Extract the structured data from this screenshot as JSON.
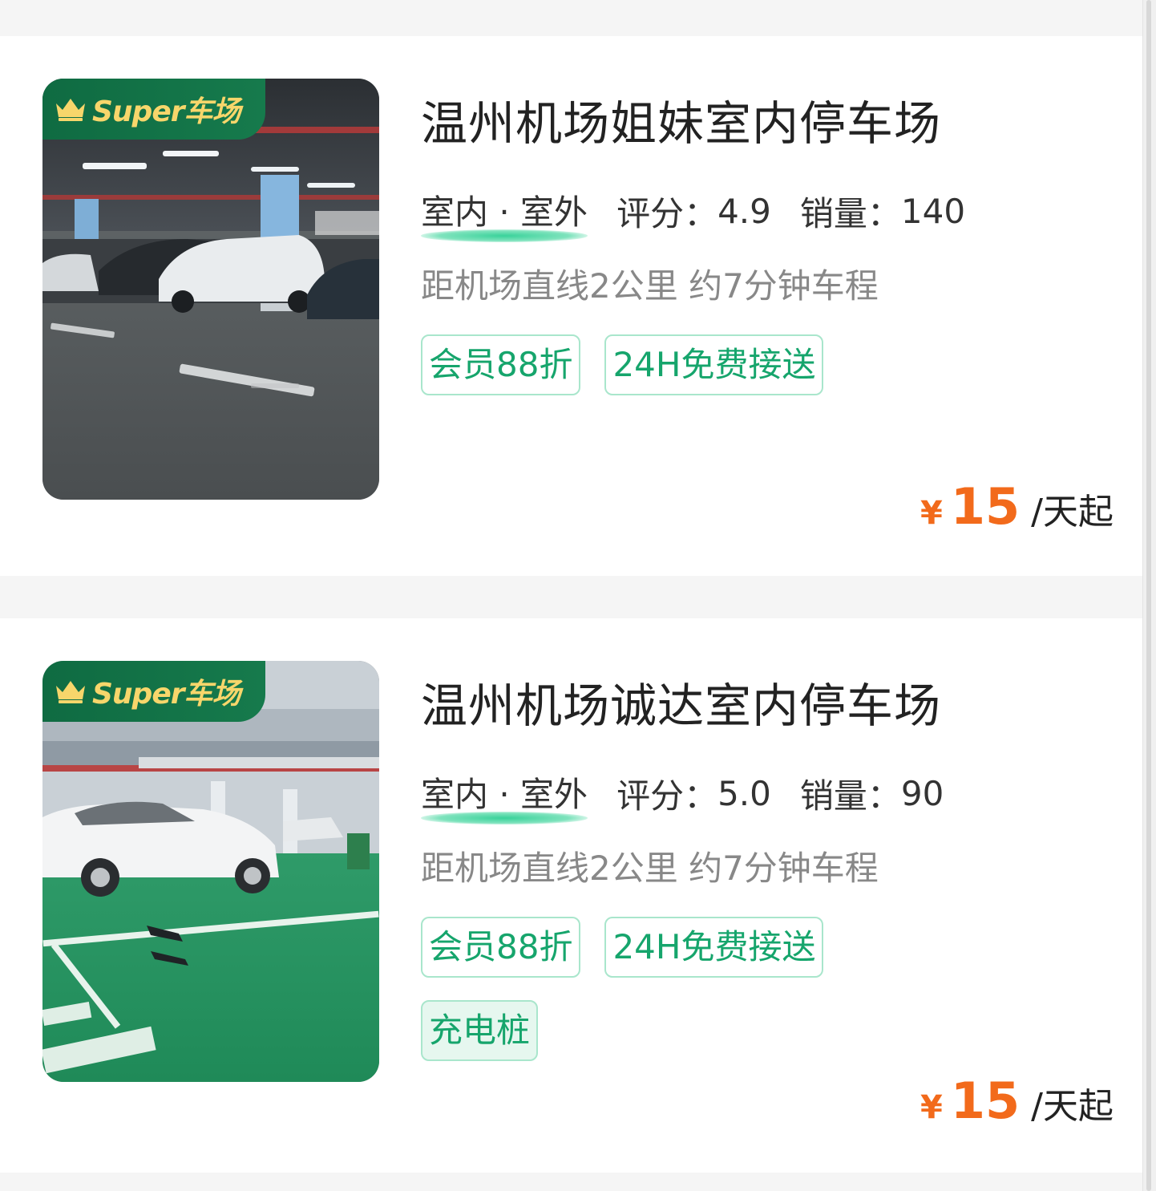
{
  "lots": [
    {
      "badge": "Super车场",
      "title": "温州机场姐妹室内停车场",
      "venue": "室内 · 室外",
      "rating_label": "评分：",
      "rating": "4.9",
      "sales_label": "销量：",
      "sales": "140",
      "distance": "距机场直线2公里 约7分钟车程",
      "tags": [
        "会员88折",
        "24H免费接送"
      ],
      "price_symbol": "¥",
      "price": "15",
      "price_unit": "/天起"
    },
    {
      "badge": "Super车场",
      "title": "温州机场诚达室内停车场",
      "venue": "室内 · 室外",
      "rating_label": "评分：",
      "rating": "5.0",
      "sales_label": "销量：",
      "sales": "90",
      "distance": "距机场直线2公里 约7分钟车程",
      "tags": [
        "会员88折",
        "24H免费接送",
        "充电桩"
      ],
      "price_symbol": "¥",
      "price": "15",
      "price_unit": "/天起"
    }
  ],
  "colors": {
    "accent_green": "#16a56c",
    "badge_green": "#0f6b42",
    "badge_text": "#f7d66b",
    "price_orange": "#f26a1b"
  },
  "icons": [
    "crown-icon"
  ]
}
